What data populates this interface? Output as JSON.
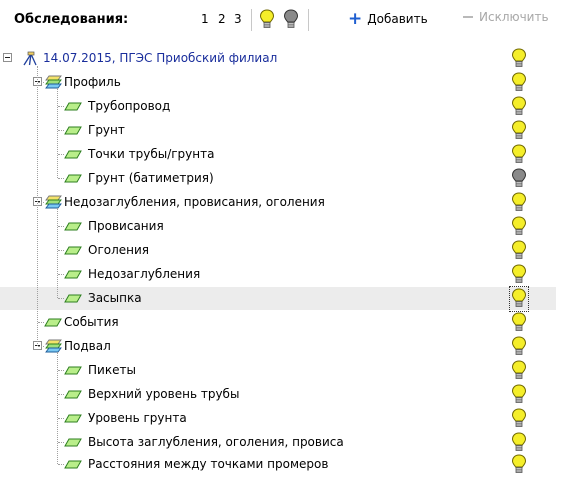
{
  "toolbar": {
    "title": "Обследования:",
    "levels": [
      "1",
      "2",
      "3"
    ],
    "bulb_on_icon": "lightbulb-on-icon",
    "bulb_off_icon": "lightbulb-off-icon",
    "add_label": "Добавить",
    "exclude_label": "Исключить"
  },
  "tree": {
    "rows": [
      {
        "label": "14.07.2015, ПГЭС Приобский филиал",
        "icon": "survey-icon",
        "status": "on"
      },
      {
        "label": "Профиль",
        "icon": "layers-icon",
        "status": "on"
      },
      {
        "label": "Трубопровод",
        "icon": "layer-icon",
        "status": "on"
      },
      {
        "label": "Грунт",
        "icon": "layer-icon",
        "status": "on"
      },
      {
        "label": "Точки трубы/грунта",
        "icon": "layer-icon",
        "status": "on"
      },
      {
        "label": "Грунт (батиметрия)",
        "icon": "layer-icon",
        "status": "off"
      },
      {
        "label": "Недозаглубления, провисания, оголения",
        "icon": "layers-icon",
        "status": "on"
      },
      {
        "label": "Провисания",
        "icon": "layer-icon",
        "status": "on"
      },
      {
        "label": "Оголения",
        "icon": "layer-icon",
        "status": "on"
      },
      {
        "label": "Недозаглубления",
        "icon": "layer-icon",
        "status": "on"
      },
      {
        "label": "Засыпка",
        "icon": "layer-icon",
        "status": "on"
      },
      {
        "label": "События",
        "icon": "layer-icon",
        "status": "on"
      },
      {
        "label": "Подвал",
        "icon": "layers-icon",
        "status": "on"
      },
      {
        "label": "Пикеты",
        "icon": "layer-icon",
        "status": "on"
      },
      {
        "label": "Верхний уровень трубы",
        "icon": "layer-icon",
        "status": "on"
      },
      {
        "label": "Уровень грунта",
        "icon": "layer-icon",
        "status": "on"
      },
      {
        "label": "Высота заглубления, оголения, провиса",
        "icon": "layer-icon",
        "status": "on"
      },
      {
        "label": "Расстояния между точками промеров",
        "icon": "layer-icon",
        "status": "on"
      }
    ]
  },
  "colors": {
    "bulb_on": "#f5ee2a",
    "bulb_off": "#8a8a8a",
    "survey_text": "#1a2e9c",
    "add_accent": "#1f5fd0",
    "selected_row": "#ececec"
  }
}
